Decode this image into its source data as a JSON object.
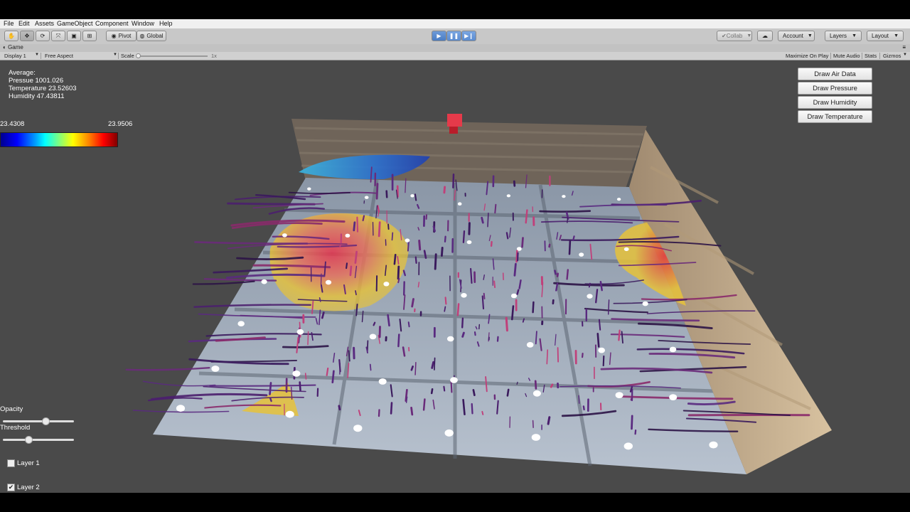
{
  "menu": [
    "File",
    "Edit",
    "Assets",
    "GameObject",
    "Component",
    "Window",
    "Help"
  ],
  "toolbar": {
    "tools": [
      "hand-tool",
      "move-tool",
      "rotate-tool",
      "scale-tool",
      "rect-tool",
      "transform-tool"
    ],
    "pivot_label": "Pivot",
    "global_label": "Global",
    "collab_label": "Collab",
    "account_label": "Account",
    "layers_label": "Layers",
    "layout_label": "Layout"
  },
  "game_view": {
    "tab_label": "Game",
    "display_label": "Display 1",
    "aspect_label": "Free Aspect",
    "scale_label": "Scale",
    "scale_value": "1x",
    "maximize_label": "Maximize On Play",
    "mute_label": "Mute Audio",
    "stats_label": "Stats",
    "gizmos_label": "Gizmos"
  },
  "overlay": {
    "average_label": "Average:",
    "pressure": "Pressue 1001.026",
    "temperature": "Temperature 23.52603",
    "humidity": "Humidity 47.43811",
    "colorbar_min": "23.4308",
    "colorbar_max": "23.9506",
    "buttons": [
      "Draw Air Data",
      "Draw Pressure",
      "Draw Humidity",
      "Draw Temperature"
    ],
    "opacity_label": "Opacity",
    "opacity_value": 0.6,
    "threshold_label": "Threshold",
    "threshold_value": 0.36,
    "layer1_label": "Layer 1",
    "layer1_checked": false,
    "layer2_label": "Layer 2",
    "layer2_checked": true
  }
}
